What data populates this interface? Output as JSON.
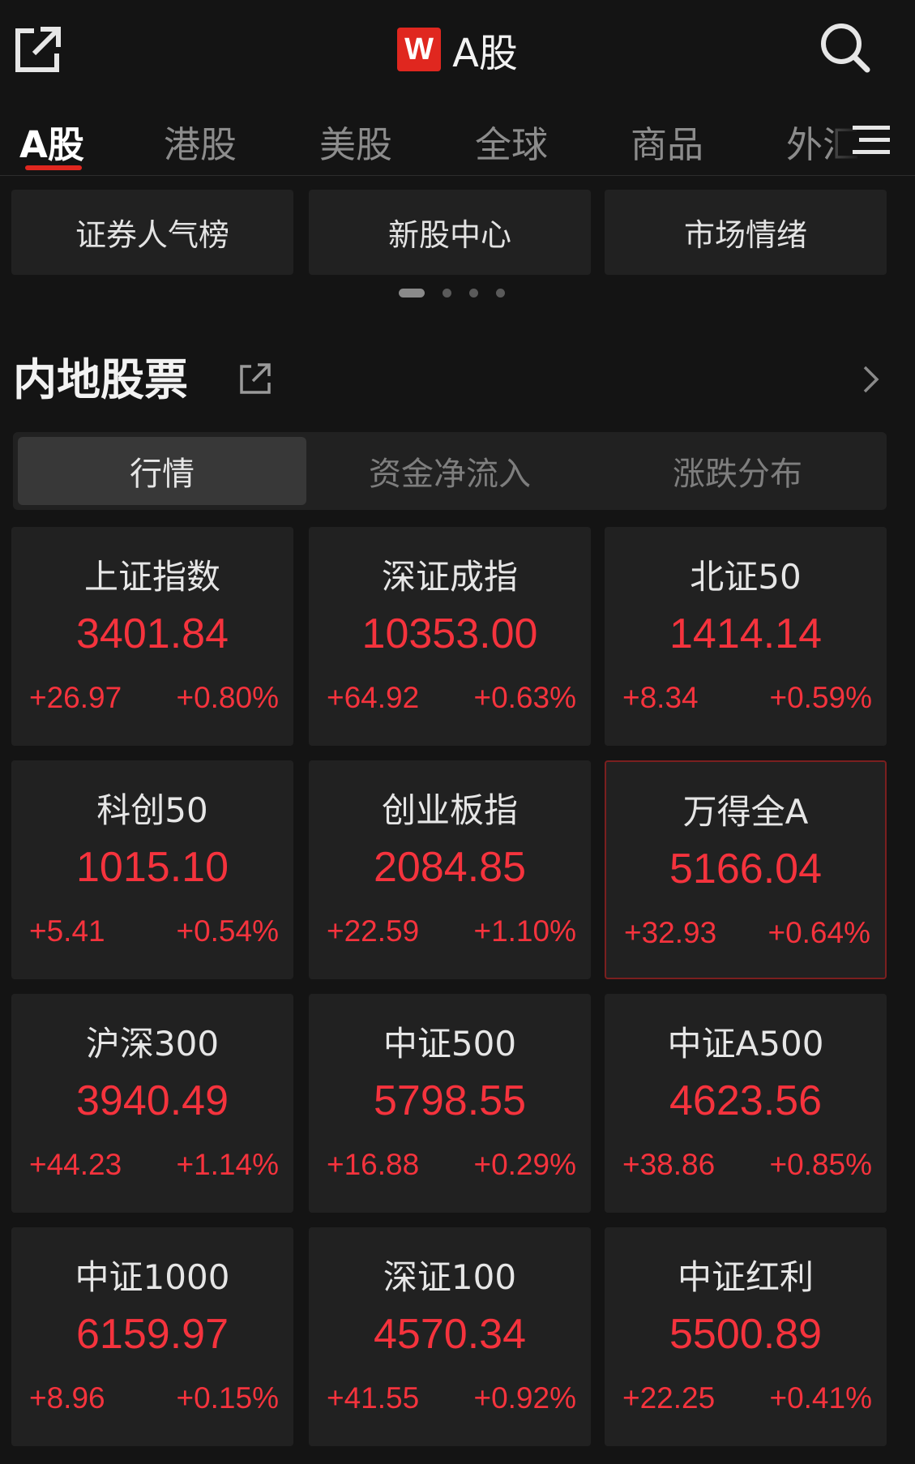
{
  "header": {
    "title": "A股",
    "logo_text": "W",
    "share_icon": "share-external-icon",
    "search_icon": "search-icon",
    "brand_color": "#e0271f"
  },
  "tabs": [
    {
      "label": "A股",
      "active": true
    },
    {
      "label": "港股",
      "active": false
    },
    {
      "label": "美股",
      "active": false
    },
    {
      "label": "全球",
      "active": false
    },
    {
      "label": "商品",
      "active": false
    },
    {
      "label": "外汇",
      "active": false
    }
  ],
  "menu_icon": "menu-icon",
  "quick_tiles": [
    {
      "label": "证券人气榜"
    },
    {
      "label": "新股中心"
    },
    {
      "label": "市场情绪"
    }
  ],
  "pager": {
    "count": 4,
    "active": 0
  },
  "section": {
    "title": "内地股票",
    "share_icon": "share-external-icon",
    "more_icon": "chevron-right-icon"
  },
  "segments": [
    {
      "label": "行情",
      "active": true
    },
    {
      "label": "资金净流入",
      "active": false
    },
    {
      "label": "涨跌分布",
      "active": false
    }
  ],
  "colors": {
    "up": "#f5333d",
    "background": "#141414",
    "card": "#212121"
  },
  "indices": [
    {
      "name": "上证指数",
      "value": "3401.84",
      "change": "+26.97",
      "pct": "+0.80%"
    },
    {
      "name": "深证成指",
      "value": "10353.00",
      "change": "+64.92",
      "pct": "+0.63%"
    },
    {
      "name": "北证50",
      "value": "1414.14",
      "change": "+8.34",
      "pct": "+0.59%"
    },
    {
      "name": "科创50",
      "value": "1015.10",
      "change": "+5.41",
      "pct": "+0.54%"
    },
    {
      "name": "创业板指",
      "value": "2084.85",
      "change": "+22.59",
      "pct": "+1.10%"
    },
    {
      "name": "万得全A",
      "value": "5166.04",
      "change": "+32.93",
      "pct": "+0.64%"
    },
    {
      "name": "沪深300",
      "value": "3940.49",
      "change": "+44.23",
      "pct": "+1.14%"
    },
    {
      "name": "中证500",
      "value": "5798.55",
      "change": "+16.88",
      "pct": "+0.29%"
    },
    {
      "name": "中证A500",
      "value": "4623.56",
      "change": "+38.86",
      "pct": "+0.85%"
    },
    {
      "name": "中证1000",
      "value": "6159.97",
      "change": "+8.96",
      "pct": "+0.15%"
    },
    {
      "name": "深证100",
      "value": "4570.34",
      "change": "+41.55",
      "pct": "+0.92%"
    },
    {
      "name": "中证红利",
      "value": "5500.89",
      "change": "+22.25",
      "pct": "+0.41%"
    }
  ]
}
